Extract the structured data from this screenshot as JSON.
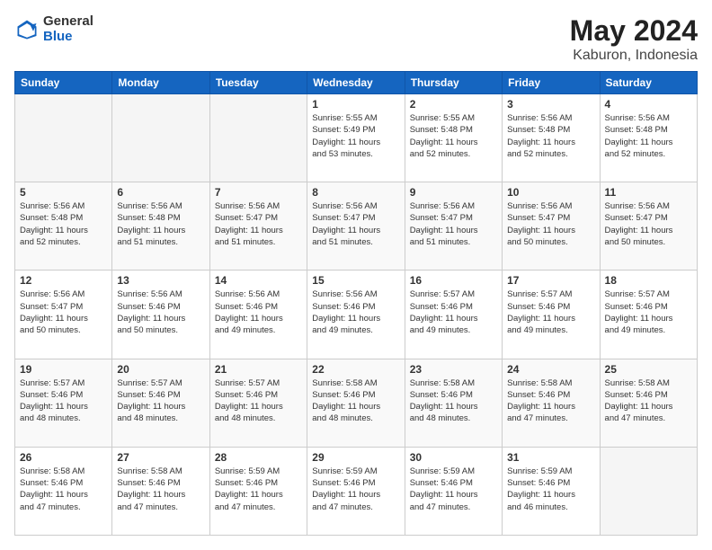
{
  "logo": {
    "general": "General",
    "blue": "Blue"
  },
  "title": "May 2024",
  "location": "Kaburon, Indonesia",
  "headers": [
    "Sunday",
    "Monday",
    "Tuesday",
    "Wednesday",
    "Thursday",
    "Friday",
    "Saturday"
  ],
  "weeks": [
    [
      {
        "day": "",
        "info": ""
      },
      {
        "day": "",
        "info": ""
      },
      {
        "day": "",
        "info": ""
      },
      {
        "day": "1",
        "info": "Sunrise: 5:55 AM\nSunset: 5:49 PM\nDaylight: 11 hours\nand 53 minutes."
      },
      {
        "day": "2",
        "info": "Sunrise: 5:55 AM\nSunset: 5:48 PM\nDaylight: 11 hours\nand 52 minutes."
      },
      {
        "day": "3",
        "info": "Sunrise: 5:56 AM\nSunset: 5:48 PM\nDaylight: 11 hours\nand 52 minutes."
      },
      {
        "day": "4",
        "info": "Sunrise: 5:56 AM\nSunset: 5:48 PM\nDaylight: 11 hours\nand 52 minutes."
      }
    ],
    [
      {
        "day": "5",
        "info": "Sunrise: 5:56 AM\nSunset: 5:48 PM\nDaylight: 11 hours\nand 52 minutes."
      },
      {
        "day": "6",
        "info": "Sunrise: 5:56 AM\nSunset: 5:48 PM\nDaylight: 11 hours\nand 51 minutes."
      },
      {
        "day": "7",
        "info": "Sunrise: 5:56 AM\nSunset: 5:47 PM\nDaylight: 11 hours\nand 51 minutes."
      },
      {
        "day": "8",
        "info": "Sunrise: 5:56 AM\nSunset: 5:47 PM\nDaylight: 11 hours\nand 51 minutes."
      },
      {
        "day": "9",
        "info": "Sunrise: 5:56 AM\nSunset: 5:47 PM\nDaylight: 11 hours\nand 51 minutes."
      },
      {
        "day": "10",
        "info": "Sunrise: 5:56 AM\nSunset: 5:47 PM\nDaylight: 11 hours\nand 50 minutes."
      },
      {
        "day": "11",
        "info": "Sunrise: 5:56 AM\nSunset: 5:47 PM\nDaylight: 11 hours\nand 50 minutes."
      }
    ],
    [
      {
        "day": "12",
        "info": "Sunrise: 5:56 AM\nSunset: 5:47 PM\nDaylight: 11 hours\nand 50 minutes."
      },
      {
        "day": "13",
        "info": "Sunrise: 5:56 AM\nSunset: 5:46 PM\nDaylight: 11 hours\nand 50 minutes."
      },
      {
        "day": "14",
        "info": "Sunrise: 5:56 AM\nSunset: 5:46 PM\nDaylight: 11 hours\nand 49 minutes."
      },
      {
        "day": "15",
        "info": "Sunrise: 5:56 AM\nSunset: 5:46 PM\nDaylight: 11 hours\nand 49 minutes."
      },
      {
        "day": "16",
        "info": "Sunrise: 5:57 AM\nSunset: 5:46 PM\nDaylight: 11 hours\nand 49 minutes."
      },
      {
        "day": "17",
        "info": "Sunrise: 5:57 AM\nSunset: 5:46 PM\nDaylight: 11 hours\nand 49 minutes."
      },
      {
        "day": "18",
        "info": "Sunrise: 5:57 AM\nSunset: 5:46 PM\nDaylight: 11 hours\nand 49 minutes."
      }
    ],
    [
      {
        "day": "19",
        "info": "Sunrise: 5:57 AM\nSunset: 5:46 PM\nDaylight: 11 hours\nand 48 minutes."
      },
      {
        "day": "20",
        "info": "Sunrise: 5:57 AM\nSunset: 5:46 PM\nDaylight: 11 hours\nand 48 minutes."
      },
      {
        "day": "21",
        "info": "Sunrise: 5:57 AM\nSunset: 5:46 PM\nDaylight: 11 hours\nand 48 minutes."
      },
      {
        "day": "22",
        "info": "Sunrise: 5:58 AM\nSunset: 5:46 PM\nDaylight: 11 hours\nand 48 minutes."
      },
      {
        "day": "23",
        "info": "Sunrise: 5:58 AM\nSunset: 5:46 PM\nDaylight: 11 hours\nand 48 minutes."
      },
      {
        "day": "24",
        "info": "Sunrise: 5:58 AM\nSunset: 5:46 PM\nDaylight: 11 hours\nand 47 minutes."
      },
      {
        "day": "25",
        "info": "Sunrise: 5:58 AM\nSunset: 5:46 PM\nDaylight: 11 hours\nand 47 minutes."
      }
    ],
    [
      {
        "day": "26",
        "info": "Sunrise: 5:58 AM\nSunset: 5:46 PM\nDaylight: 11 hours\nand 47 minutes."
      },
      {
        "day": "27",
        "info": "Sunrise: 5:58 AM\nSunset: 5:46 PM\nDaylight: 11 hours\nand 47 minutes."
      },
      {
        "day": "28",
        "info": "Sunrise: 5:59 AM\nSunset: 5:46 PM\nDaylight: 11 hours\nand 47 minutes."
      },
      {
        "day": "29",
        "info": "Sunrise: 5:59 AM\nSunset: 5:46 PM\nDaylight: 11 hours\nand 47 minutes."
      },
      {
        "day": "30",
        "info": "Sunrise: 5:59 AM\nSunset: 5:46 PM\nDaylight: 11 hours\nand 47 minutes."
      },
      {
        "day": "31",
        "info": "Sunrise: 5:59 AM\nSunset: 5:46 PM\nDaylight: 11 hours\nand 46 minutes."
      },
      {
        "day": "",
        "info": ""
      }
    ]
  ]
}
